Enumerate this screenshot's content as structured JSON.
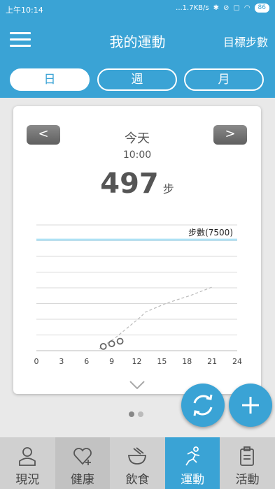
{
  "status_bar": {
    "time": "上午10:14",
    "network_speed": "...1.7KB/s",
    "battery": "86"
  },
  "app_bar": {
    "title": "我的運動",
    "target_steps_label": "目標步數"
  },
  "period_tabs": [
    {
      "label": "日",
      "active": true
    },
    {
      "label": "週",
      "active": false
    },
    {
      "label": "月",
      "active": false
    }
  ],
  "card": {
    "prev_label": "<",
    "next_label": ">",
    "day": "今天",
    "time": "10:00",
    "steps": "497",
    "steps_unit": "步"
  },
  "chart_data": {
    "type": "line",
    "goal_label": "步數(7500)",
    "goal": 7500,
    "x_ticks": [
      "0",
      "3",
      "6",
      "9",
      "12",
      "15",
      "18",
      "21",
      "24"
    ],
    "xlim": [
      0,
      24
    ],
    "ylim": [
      0,
      8500
    ],
    "grid": true,
    "series": [
      {
        "style": "circles",
        "x": [
          8,
          9,
          10
        ],
        "y": [
          100,
          280,
          450
        ]
      },
      {
        "style": "dashed",
        "x": [
          7.5,
          9.5,
          12.5,
          13,
          15.5,
          18.5,
          21
        ],
        "y": [
          120,
          900,
          2300,
          2600,
          3200,
          3750,
          4300
        ]
      }
    ],
    "colors": {
      "goal": "#aee2f5",
      "grid": "#d8d8d8",
      "dashed": "#bbbbbb",
      "circle": "#666666"
    }
  },
  "pager": {
    "count": 2,
    "active": 0
  },
  "bottom_nav": [
    {
      "label": "現況",
      "icon": "person-icon",
      "state": "normal"
    },
    {
      "label": "健康",
      "icon": "heart-plus-icon",
      "state": "dim"
    },
    {
      "label": "飲食",
      "icon": "bowl-icon",
      "state": "normal"
    },
    {
      "label": "運動",
      "icon": "runner-icon",
      "state": "active"
    },
    {
      "label": "活動",
      "icon": "clipboard-icon",
      "state": "normal"
    }
  ],
  "colors": {
    "accent": "#3aa3d5"
  }
}
